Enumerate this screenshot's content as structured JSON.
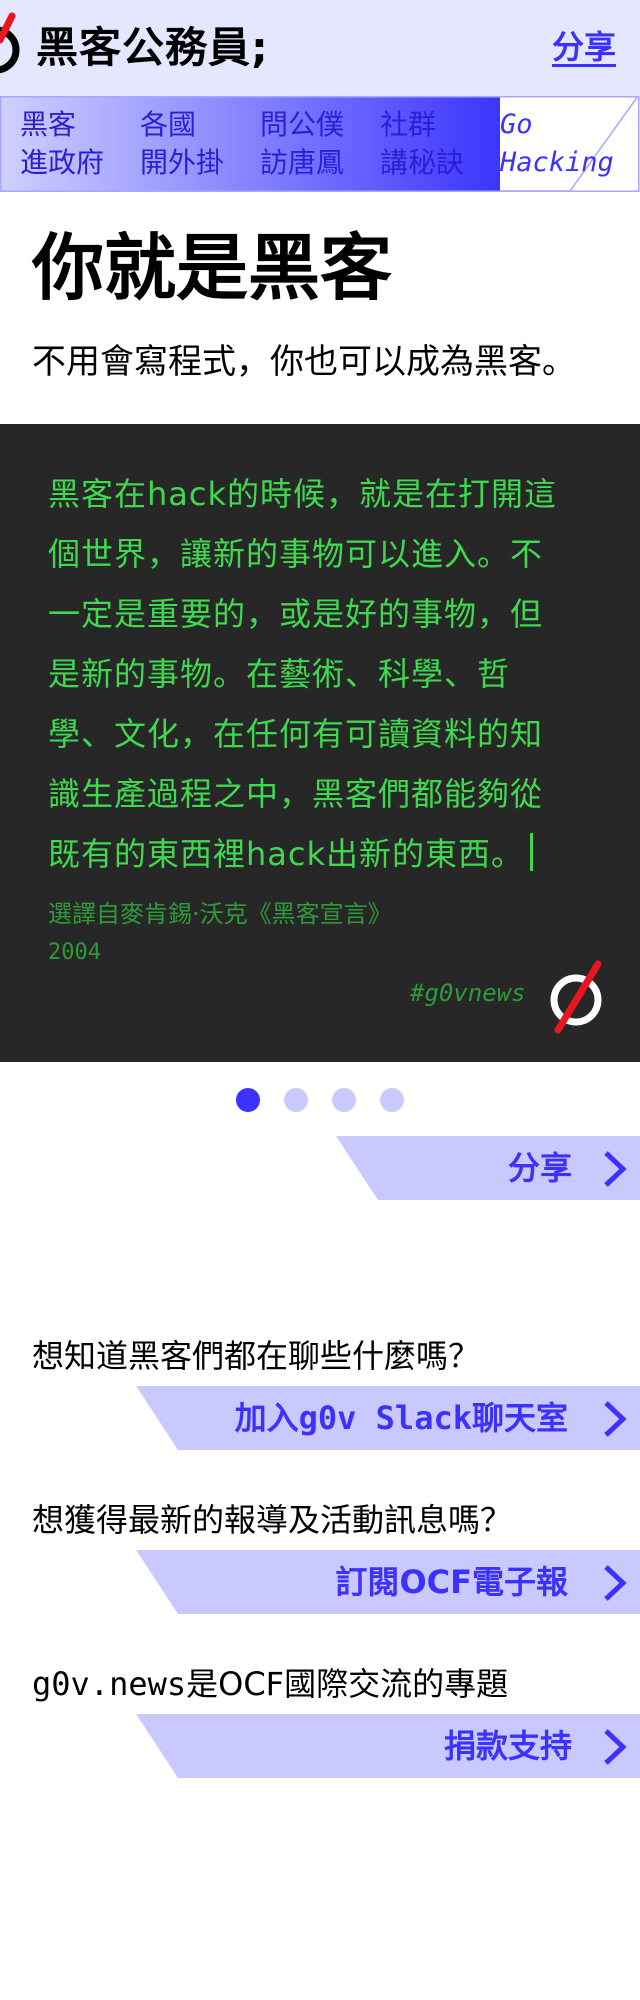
{
  "header": {
    "title": "黑客公務員;",
    "share_label": "分享",
    "logo_icon": "g0v-logo-icon"
  },
  "nav": {
    "items": [
      {
        "line1": "黑客",
        "line2": "進政府"
      },
      {
        "line1": "各國",
        "line2": "開外掛"
      },
      {
        "line1": "問公僕",
        "line2": "訪唐鳳"
      },
      {
        "line1": "社群",
        "line2": "講秘訣"
      }
    ],
    "go_line1": "Go",
    "go_line2": "Hacking"
  },
  "hero": {
    "title": "你就是黑客",
    "subtitle": "不用會寫程式，你也可以成為黑客。"
  },
  "quote": {
    "lines": [
      "黑客在hack的時候，就是在打開這",
      "個世界，讓新的事物可以進入。不",
      "一定是重要的，或是好的事物，但",
      "是新的事物。在藝術、科學、哲",
      "學、文化，在任何有可讀資料的知",
      "識生產過程之中，黑客們都能夠從",
      "既有的東西裡hack出新的東西。"
    ],
    "source": "選譯自麥肯錫·沃克《黑客宣言》",
    "year": "2004",
    "hashtag": "#g0vnews"
  },
  "carousel": {
    "dot_count": 4,
    "active_index": 0
  },
  "share_cta": {
    "label": "分享"
  },
  "sections": [
    {
      "question": "想知道黑客們都在聊些什麼嗎？",
      "cta_prefix": "加入",
      "cta_mono": "g0v Slack",
      "cta_suffix": "聊天室"
    },
    {
      "question": "想獲得最新的報導及活動訊息嗎？",
      "cta_prefix": "訂閱",
      "cta_mono": "OCF",
      "cta_suffix": "電子報"
    },
    {
      "question_mono": "g0v.news",
      "question_rest": "是OCF國際交流的專題",
      "cta_prefix": "捐款支持",
      "cta_mono": "",
      "cta_suffix": ""
    }
  ],
  "colors": {
    "accent": "#3c32ff",
    "light_accent": "#c9c8ff",
    "header_bg": "#e5e6ff",
    "quote_bg": "#272727",
    "quote_text": "#3ed94e",
    "logo_red": "#e8161f"
  }
}
